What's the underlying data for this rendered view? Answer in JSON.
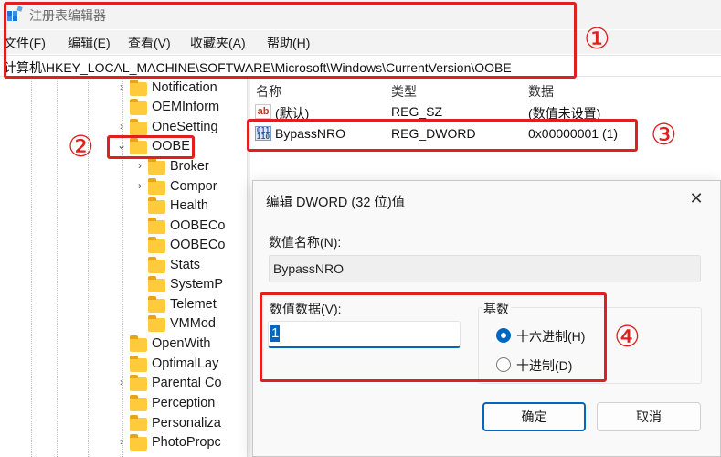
{
  "window": {
    "title": "注册表编辑器",
    "icon": "registry-editor-icon"
  },
  "menu": [
    "文件(F)",
    "编辑(E)",
    "查看(V)",
    "收藏夹(A)",
    "帮助(H)"
  ],
  "address": "计算机\\HKEY_LOCAL_MACHINE\\SOFTWARE\\Microsoft\\Windows\\CurrentVersion\\OOBE",
  "tree": [
    {
      "label": "Notification"
    },
    {
      "label": "OEMInform"
    },
    {
      "label": "OneSetting"
    },
    {
      "label": "OOBE"
    },
    {
      "label": "Broker"
    },
    {
      "label": "Compor"
    },
    {
      "label": "Health"
    },
    {
      "label": "OOBECo"
    },
    {
      "label": "OOBECo"
    },
    {
      "label": "Stats"
    },
    {
      "label": "SystemP"
    },
    {
      "label": "Telemet"
    },
    {
      "label": "VMMod"
    },
    {
      "label": "OpenWith"
    },
    {
      "label": "OptimalLay"
    },
    {
      "label": "Parental Co"
    },
    {
      "label": "Perception"
    },
    {
      "label": "Personaliza"
    },
    {
      "label": "PhotoPropc"
    }
  ],
  "list": {
    "columns": [
      "名称",
      "类型",
      "数据"
    ],
    "rows": [
      {
        "name": "(默认)",
        "type": "REG_SZ",
        "data": "(数值未设置)",
        "icon": "string-value-icon"
      },
      {
        "name": "BypassNRO",
        "type": "REG_DWORD",
        "data": "0x00000001 (1)",
        "icon": "binary-value-icon"
      }
    ]
  },
  "dialog": {
    "title": "编辑 DWORD (32 位)值",
    "value_name_label": "数值名称(N):",
    "value_name": "BypassNRO",
    "value_data_label": "数值数据(V):",
    "value_data": "1",
    "base_label": "基数",
    "hex_label": "十六进制(H)",
    "dec_label": "十进制(D)",
    "selected_base": "hex",
    "ok": "确定",
    "cancel": "取消"
  },
  "annotations": [
    "①",
    "②",
    "③",
    "④"
  ],
  "colors": {
    "annotation": "#e0201f",
    "accent": "#0067c0",
    "folder": "#ffcb3d"
  }
}
